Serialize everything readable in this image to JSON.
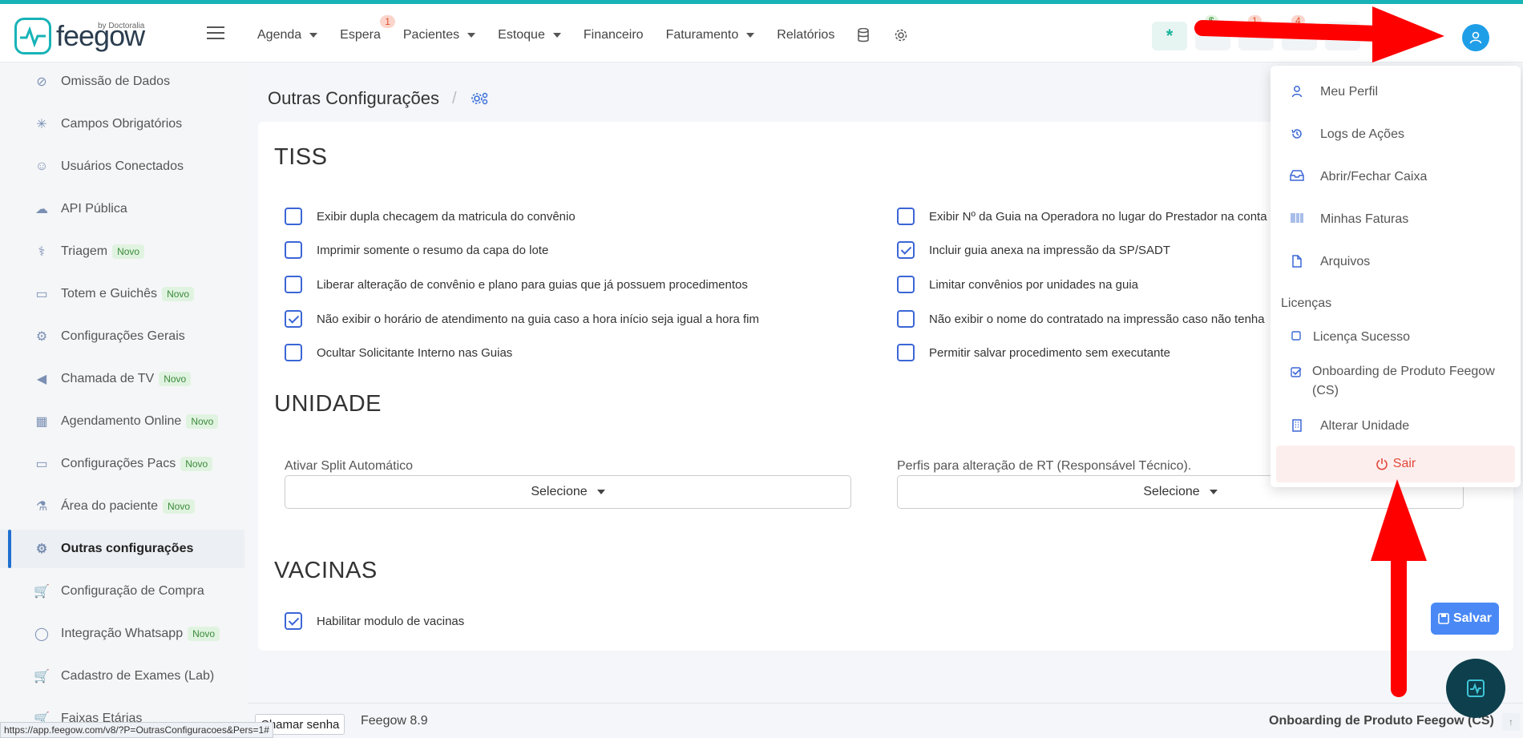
{
  "brand": {
    "name": "feegow",
    "by": "by Doctoralia",
    "accent": "#17b3b7"
  },
  "nav": {
    "items": [
      {
        "label": "Agenda",
        "dropdown": true,
        "badge": ""
      },
      {
        "label": "Espera",
        "dropdown": false,
        "badge": "1"
      },
      {
        "label": "Pacientes",
        "dropdown": true,
        "badge": ""
      },
      {
        "label": "Estoque",
        "dropdown": true,
        "badge": ""
      },
      {
        "label": "Financeiro",
        "dropdown": false,
        "badge": ""
      },
      {
        "label": "Faturamento",
        "dropdown": true,
        "badge": ""
      },
      {
        "label": "Relatórios",
        "dropdown": false,
        "badge": ""
      }
    ],
    "icons": [
      "database-icon",
      "gear-icon"
    ],
    "tool_badges": [
      "$",
      "1",
      "4"
    ]
  },
  "sidebar": {
    "items": [
      {
        "label": "Omissão de Dados",
        "icon": "eye-slash-icon",
        "novo": false,
        "active": false
      },
      {
        "label": "Campos Obrigatórios",
        "icon": "asterisk-icon",
        "novo": false,
        "active": false
      },
      {
        "label": "Usuários Conectados",
        "icon": "user-icon",
        "novo": false,
        "active": false
      },
      {
        "label": "API Pública",
        "icon": "cloud-upload-icon",
        "novo": false,
        "active": false
      },
      {
        "label": "Triagem",
        "icon": "stethoscope-icon",
        "novo": true,
        "active": false
      },
      {
        "label": "Totem e Guichês",
        "icon": "laptop-icon",
        "novo": true,
        "active": false
      },
      {
        "label": "Configurações Gerais",
        "icon": "gears-icon",
        "novo": false,
        "active": false
      },
      {
        "label": "Chamada de TV",
        "icon": "megaphone-icon",
        "novo": true,
        "active": false
      },
      {
        "label": "Agendamento Online",
        "icon": "calendar-icon",
        "novo": true,
        "active": false
      },
      {
        "label": "Configurações Pacs",
        "icon": "laptop-icon",
        "novo": true,
        "active": false
      },
      {
        "label": "Área do paciente",
        "icon": "flask-icon",
        "novo": true,
        "active": false
      },
      {
        "label": "Outras configurações",
        "icon": "gears-icon",
        "novo": false,
        "active": true
      },
      {
        "label": "Configuração de Compra",
        "icon": "cart-icon",
        "novo": false,
        "active": false
      },
      {
        "label": "Integração Whatsapp",
        "icon": "whatsapp-icon",
        "novo": true,
        "active": false
      },
      {
        "label": "Cadastro de Exames (Lab)",
        "icon": "cart-icon",
        "novo": false,
        "active": false
      },
      {
        "label": "Faixas Etárias",
        "icon": "cart-icon",
        "novo": false,
        "active": false
      }
    ],
    "novo_label": "Novo"
  },
  "page": {
    "title": "Outras Configurações",
    "separator": "/"
  },
  "tiss": {
    "title": "TISS",
    "left": [
      {
        "label": "Exibir dupla checagem da matricula do convênio",
        "checked": false
      },
      {
        "label": "Imprimir somente o resumo da capa do lote",
        "checked": false
      },
      {
        "label": "Liberar alteração de convênio e plano para guias que já possuem procedimentos",
        "checked": false
      },
      {
        "label": "Não exibir o horário de atendimento na guia caso a hora início seja igual a hora fim",
        "checked": true
      },
      {
        "label": "Ocultar Solicitante Interno nas Guias",
        "checked": false
      }
    ],
    "right": [
      {
        "label": "Exibir Nº da Guia na Operadora no lugar do Prestador na conta",
        "checked": false
      },
      {
        "label": "Incluir guia anexa na impressão da SP/SADT",
        "checked": true
      },
      {
        "label": "Limitar convênios por unidades na guia",
        "checked": false
      },
      {
        "label": "Não exibir o nome do contratado na impressão caso não tenha",
        "checked": false
      },
      {
        "label": "Permitir salvar procedimento sem executante",
        "checked": false
      }
    ]
  },
  "unidade": {
    "title": "UNIDADE",
    "split_label": "Ativar Split Automático",
    "split_value": "Selecione",
    "rt_label": "Perfis para alteração de RT (Responsável Técnico).",
    "rt_value": "Selecione"
  },
  "vacinas": {
    "title": "VACINAS",
    "item": {
      "label": "Habilitar modulo de vacinas",
      "checked": true
    }
  },
  "save_label": "Salvar",
  "user_menu": {
    "items": [
      {
        "label": "Meu Perfil",
        "icon": "user-icon"
      },
      {
        "label": "Logs de Ações",
        "icon": "history-icon"
      },
      {
        "label": "Abrir/Fechar Caixa",
        "icon": "inbox-icon"
      },
      {
        "label": "Minhas Faturas",
        "icon": "barcode-icon"
      },
      {
        "label": "Arquivos",
        "icon": "file-icon"
      }
    ],
    "licenses_header": "Licenças",
    "licenses": [
      {
        "label": "Licença Sucesso",
        "checked": false
      },
      {
        "label": "Onboarding de Produto Feegow (CS)",
        "checked": true
      }
    ],
    "change_unit": "Alterar Unidade",
    "logout": "Sair"
  },
  "footer": {
    "chamar_label": "Chamar senha",
    "version": "Feegow 8.9",
    "unit": "Onboarding de Produto Feegow (CS)",
    "status_url": "https://app.feegow.com/v8/?P=OutrasConfiguracoes&Pers=1#"
  },
  "colors": {
    "primary": "#3b66d6",
    "avatar": "#1f9ee8",
    "arrow": "#ff0000",
    "logout": "#e2493a"
  }
}
